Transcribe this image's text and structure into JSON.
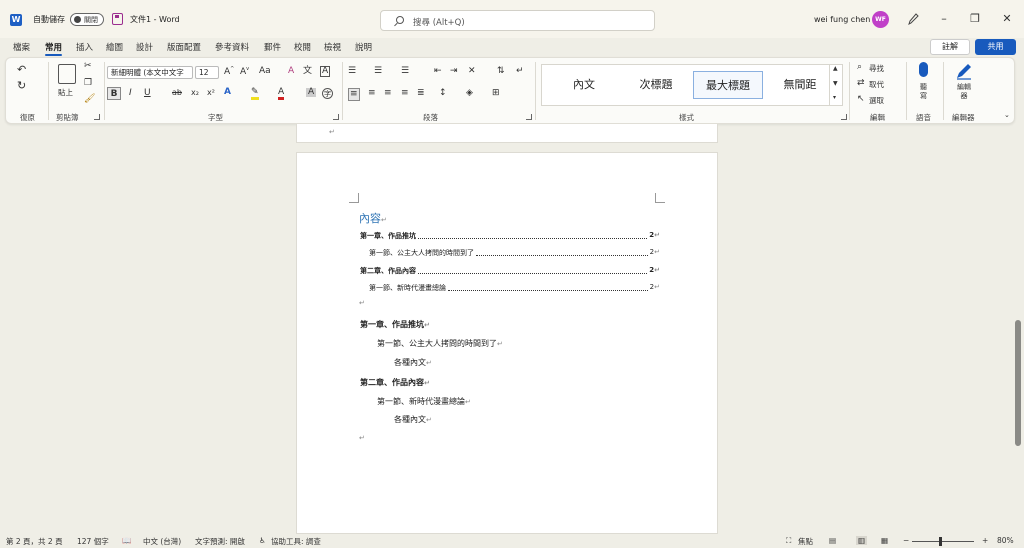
{
  "titlebar": {
    "app_icon": "W",
    "autosave_label": "自動儲存",
    "autosave_state": "關閉",
    "doc_title": "文件1 - Word",
    "search_placeholder": "搜尋 (Alt+Q)",
    "user_name": "wei fung chen",
    "user_initials": "WF",
    "window_controls": [
      "–",
      "❐",
      "✕"
    ]
  },
  "tabs": [
    "檔案",
    "常用",
    "插入",
    "繪圖",
    "設計",
    "版面配置",
    "參考資料",
    "郵件",
    "校閱",
    "檢視",
    "說明"
  ],
  "active_tab": "常用",
  "actions": {
    "comment": "註解",
    "share": "共用"
  },
  "ribbon": {
    "groups": {
      "undo": "復原",
      "clipboard": "剪貼簿",
      "font": "字型",
      "paragraph": "段落",
      "styles": "樣式",
      "editing": "編輯",
      "voice": "語音",
      "editor": "編輯器"
    },
    "paste_label": "貼上",
    "font_name": "新細明體 (本文中文字",
    "font_size": "12",
    "styles": [
      "內文",
      "次標題",
      "最大標題",
      "無間距"
    ],
    "selected_style": "最大標題",
    "find": "尋找",
    "replace": "取代",
    "select": "選取",
    "dictate": "聽寫",
    "editor_btn": "編輯器"
  },
  "document": {
    "toc_title": "內容",
    "toc": [
      {
        "text": "第一章、作品推坑",
        "page": "2",
        "level": 1
      },
      {
        "text": "第一節、公主大人拷問的時間到了",
        "page": "2",
        "level": 2
      },
      {
        "text": "第二章、作品內容",
        "page": "2",
        "level": 1
      },
      {
        "text": "第一節、新時代漫畫總論",
        "page": "2",
        "level": 2
      }
    ],
    "body": [
      {
        "text": "第一章、作品推坑",
        "level": 1
      },
      {
        "text": "第一節、公主大人拷問的時間到了",
        "level": 2
      },
      {
        "text": "各種內文",
        "level": 3
      },
      {
        "text": "第二章、作品內容",
        "level": 1
      },
      {
        "text": "第一節、新時代漫畫總論",
        "level": 2
      },
      {
        "text": "各種內文",
        "level": 3
      }
    ],
    "para_mark": "↵"
  },
  "status": {
    "page": "第 2 頁，共 2 頁",
    "words": "127 個字",
    "language": "中文 (台灣)",
    "prediction": "文字預測: 開啟",
    "accessibility": "協助工具: 調查",
    "focus": "焦點",
    "zoom": "80%"
  },
  "colors": {
    "accent": "#185abd",
    "heading": "#2e74b5",
    "avatar": "#c040c8",
    "save": "#9b2d8f"
  }
}
